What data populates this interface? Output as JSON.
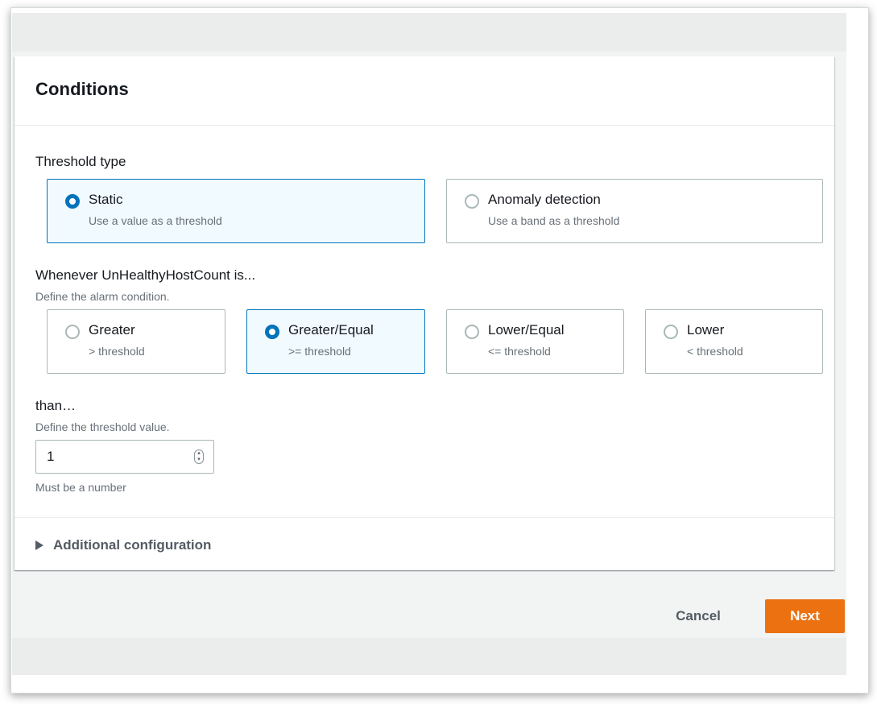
{
  "conditions": {
    "title": "Conditions",
    "threshold_type": {
      "label": "Threshold type",
      "options": [
        {
          "title": "Static",
          "subtitle": "Use a value as a threshold",
          "selected": true
        },
        {
          "title": "Anomaly detection",
          "subtitle": "Use a band as a threshold",
          "selected": false
        }
      ]
    },
    "condition": {
      "label": "Whenever UnHealthyHostCount is...",
      "description": "Define the alarm condition.",
      "options": [
        {
          "title": "Greater",
          "subtitle": "> threshold",
          "selected": false
        },
        {
          "title": "Greater/Equal",
          "subtitle": ">= threshold",
          "selected": true
        },
        {
          "title": "Lower/Equal",
          "subtitle": "<= threshold",
          "selected": false
        },
        {
          "title": "Lower",
          "subtitle": "< threshold",
          "selected": false
        }
      ]
    },
    "threshold": {
      "label": "than…",
      "description": "Define the threshold value.",
      "value": "1",
      "hint": "Must be a number"
    },
    "additional": {
      "label": "Additional configuration",
      "expanded": false,
      "icon": "caret-right-icon"
    }
  },
  "actions": {
    "cancel_label": "Cancel",
    "next_label": "Next"
  },
  "colors": {
    "accent": "#0073bb",
    "primary_button": "#ec7211",
    "selected_tile_bg": "#f1faff"
  }
}
